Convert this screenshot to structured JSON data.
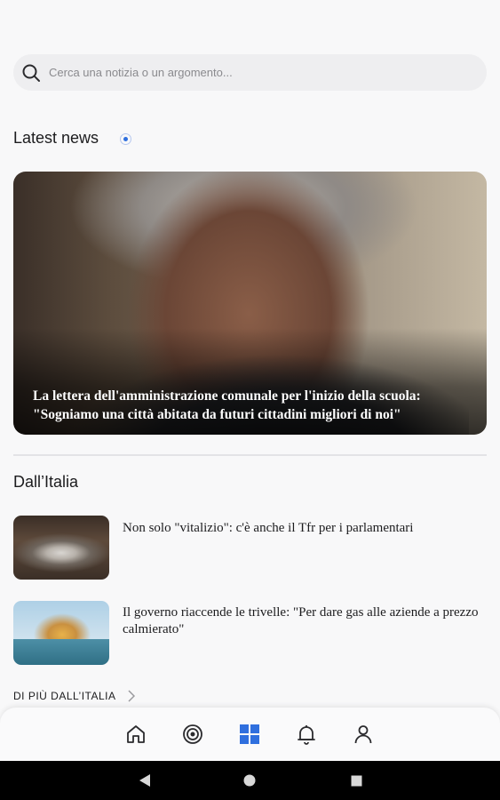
{
  "search": {
    "placeholder": "Cerca una notizia o un argomento..."
  },
  "latest": {
    "title": "Latest news",
    "hero_caption": "La lettera dell'amministrazione comunale per l'inizio della scuola: \"Sogniamo una città abitata da futuri cittadini migliori di noi\""
  },
  "italy": {
    "title": "Dall’Italia",
    "articles": [
      {
        "title": "Non solo \"vitalizio\": c'è anche il Tfr per i parlamentari"
      },
      {
        "title": "Il governo riaccende le trivelle: \"Per dare gas alle aziende a prezzo calmierato\""
      }
    ],
    "more_label": "DI PIÙ DALL’ITALIA"
  },
  "tabs": [
    {
      "icon": "home-icon",
      "active": false
    },
    {
      "icon": "target-icon",
      "active": false
    },
    {
      "icon": "grid-icon",
      "active": true
    },
    {
      "icon": "bell-icon",
      "active": false
    },
    {
      "icon": "user-icon",
      "active": false
    }
  ],
  "colors": {
    "accent": "#2f6fde",
    "text": "#1c1c1e",
    "background": "#f8f8f9"
  },
  "system_nav": {
    "icons": [
      "back-icon",
      "home-circle-icon",
      "recents-icon"
    ]
  }
}
